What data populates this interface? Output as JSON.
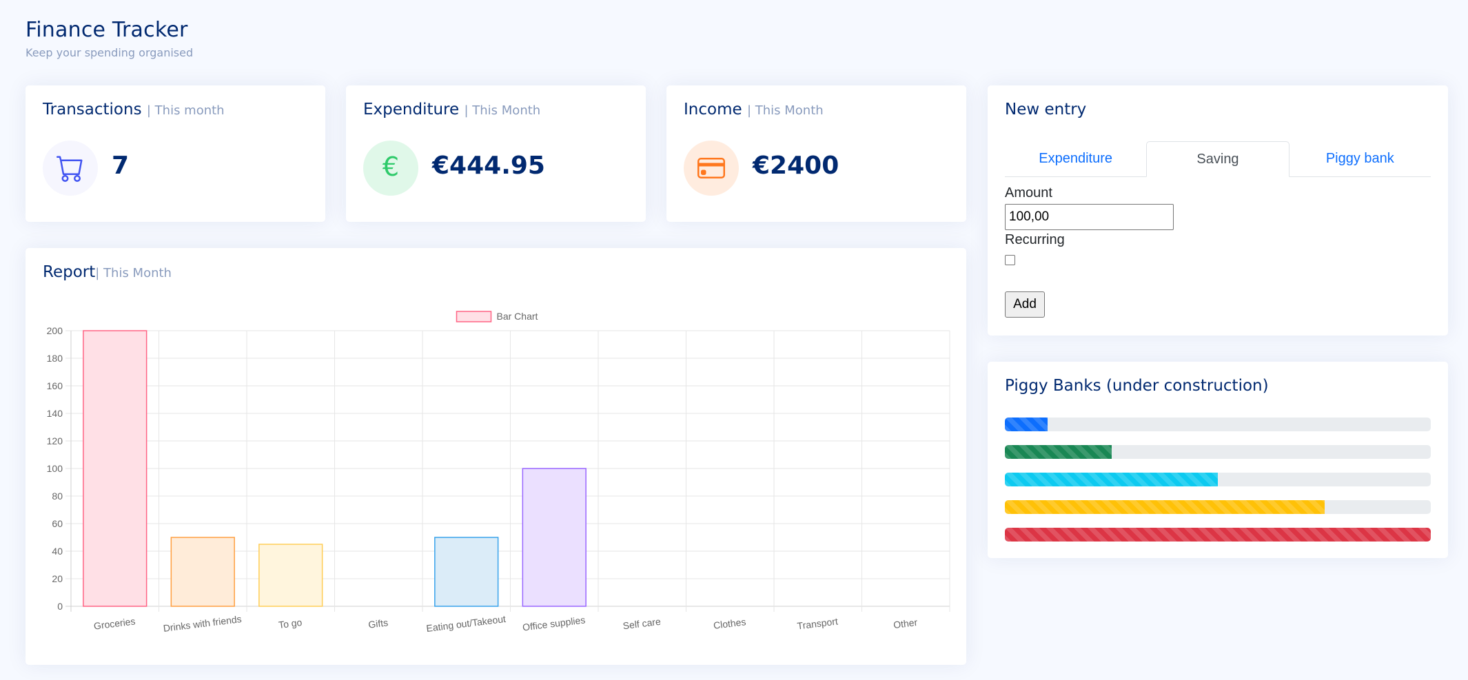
{
  "header": {
    "title": "Finance Tracker",
    "subtitle": "Keep your spending organised"
  },
  "stats": {
    "transactions": {
      "title": "Transactions",
      "period": "| This month",
      "value": "7",
      "icon": "cart-icon"
    },
    "expenditure": {
      "title": "Expenditure",
      "period": "| This Month",
      "value": "€444.95",
      "icon": "euro-icon"
    },
    "income": {
      "title": "Income",
      "period": "| This Month",
      "value": "€2400",
      "icon": "credit-card-icon"
    }
  },
  "report": {
    "title": "Report",
    "period": "| This Month"
  },
  "chart_data": {
    "type": "bar",
    "legend": [
      "Bar Chart"
    ],
    "legend_position": "top",
    "categories": [
      "Groceries",
      "Drinks with friends",
      "To go",
      "Gifts",
      "Eating out/Takeout",
      "Office supplies",
      "Self care",
      "Clothes",
      "Transport",
      "Other"
    ],
    "series": [
      {
        "name": "Bar Chart",
        "values": [
          200,
          50,
          45,
          0,
          50,
          100,
          0,
          0,
          0,
          0
        ]
      }
    ],
    "bar_fill": [
      "#ffe0e6",
      "#ffecd9",
      "#fff5dd",
      "#e4f2e7",
      "#dbecf8",
      "#ebe0ff",
      "#f4f5f5",
      "#ffe0e6",
      "#ffecd9",
      "#fff5dd"
    ],
    "bar_stroke": [
      "#ff6384",
      "#ff9f40",
      "#ffcd56",
      "#4bc0c0",
      "#36a2eb",
      "#9966ff",
      "#c9cbcf",
      "#ff6384",
      "#ff9f40",
      "#ffcd56"
    ],
    "yticks": [
      0,
      20,
      40,
      60,
      80,
      100,
      120,
      140,
      160,
      180,
      200
    ],
    "ylim": [
      0,
      200
    ],
    "grid": true
  },
  "entry": {
    "title": "New entry",
    "tabs": [
      {
        "label": "Expenditure",
        "active": false
      },
      {
        "label": "Saving",
        "active": true
      },
      {
        "label": "Piggy bank",
        "active": false
      }
    ],
    "amount_label": "Amount",
    "amount_value": "100,00",
    "recurring_label": "Recurring",
    "recurring_checked": false,
    "add_label": "Add"
  },
  "piggy": {
    "title": "Piggy Banks (under construction)",
    "bars": [
      {
        "progress": 0.1,
        "color": "#0d6efd"
      },
      {
        "progress": 0.25,
        "color": "#198754"
      },
      {
        "progress": 0.5,
        "color": "#0dcaf0"
      },
      {
        "progress": 0.75,
        "color": "#ffc107"
      },
      {
        "progress": 1.0,
        "color": "#dc3545"
      }
    ]
  }
}
